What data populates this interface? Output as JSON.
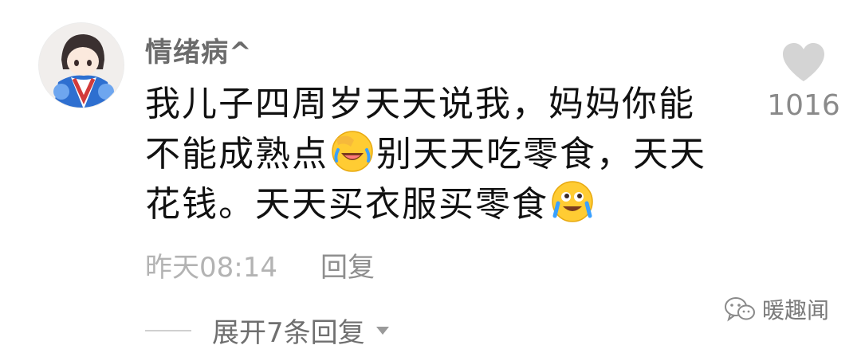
{
  "comment": {
    "username": "情绪病^",
    "text_part1": "我儿子四周岁天天说我，妈妈你能不能成熟点",
    "emoji1": "facepalm-laugh-emoji",
    "text_part2": "别天天吃零食，天天花钱。天天买衣服买零食",
    "emoji2": "teary-laugh-emoji",
    "timestamp": "昨天08:14",
    "reply_label": "回复",
    "like_count": "1016",
    "like_icon": "heart-icon"
  },
  "replies": {
    "expand_label": "展开7条回复",
    "expand_icon": "caret-down-icon"
  },
  "watermark": {
    "text": "暖趣闻",
    "icon": "wechat-icon"
  }
}
